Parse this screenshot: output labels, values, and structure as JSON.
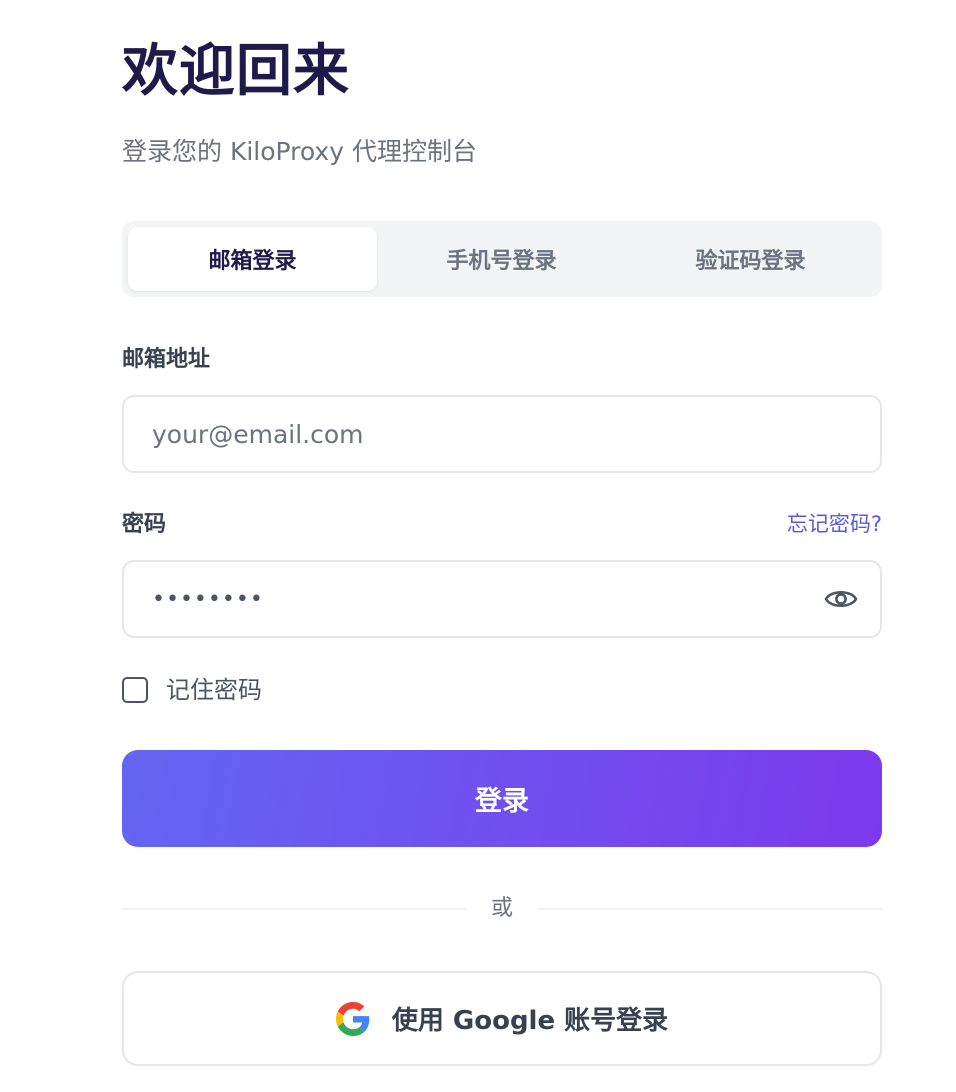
{
  "header": {
    "title": "欢迎回来",
    "subtitle": "登录您的 KiloProxy 代理控制台"
  },
  "tabs": [
    {
      "label": "邮箱登录",
      "active": true
    },
    {
      "label": "手机号登录",
      "active": false
    },
    {
      "label": "验证码登录",
      "active": false
    }
  ],
  "form": {
    "email_label": "邮箱地址",
    "email_placeholder": "your@email.com",
    "password_label": "密码",
    "forgot_label": "忘记密码?",
    "password_masked": "••••••••",
    "remember_label": "记住密码",
    "remember_checked": false,
    "submit_label": "登录"
  },
  "divider": {
    "text": "或"
  },
  "social": {
    "google_label": "使用 Google 账号登录",
    "icon": "google-icon"
  },
  "colors": {
    "title": "#1e1b4b",
    "accent_start": "#6366f1",
    "accent_end": "#7c3aed",
    "link": "#5b5bd6"
  }
}
